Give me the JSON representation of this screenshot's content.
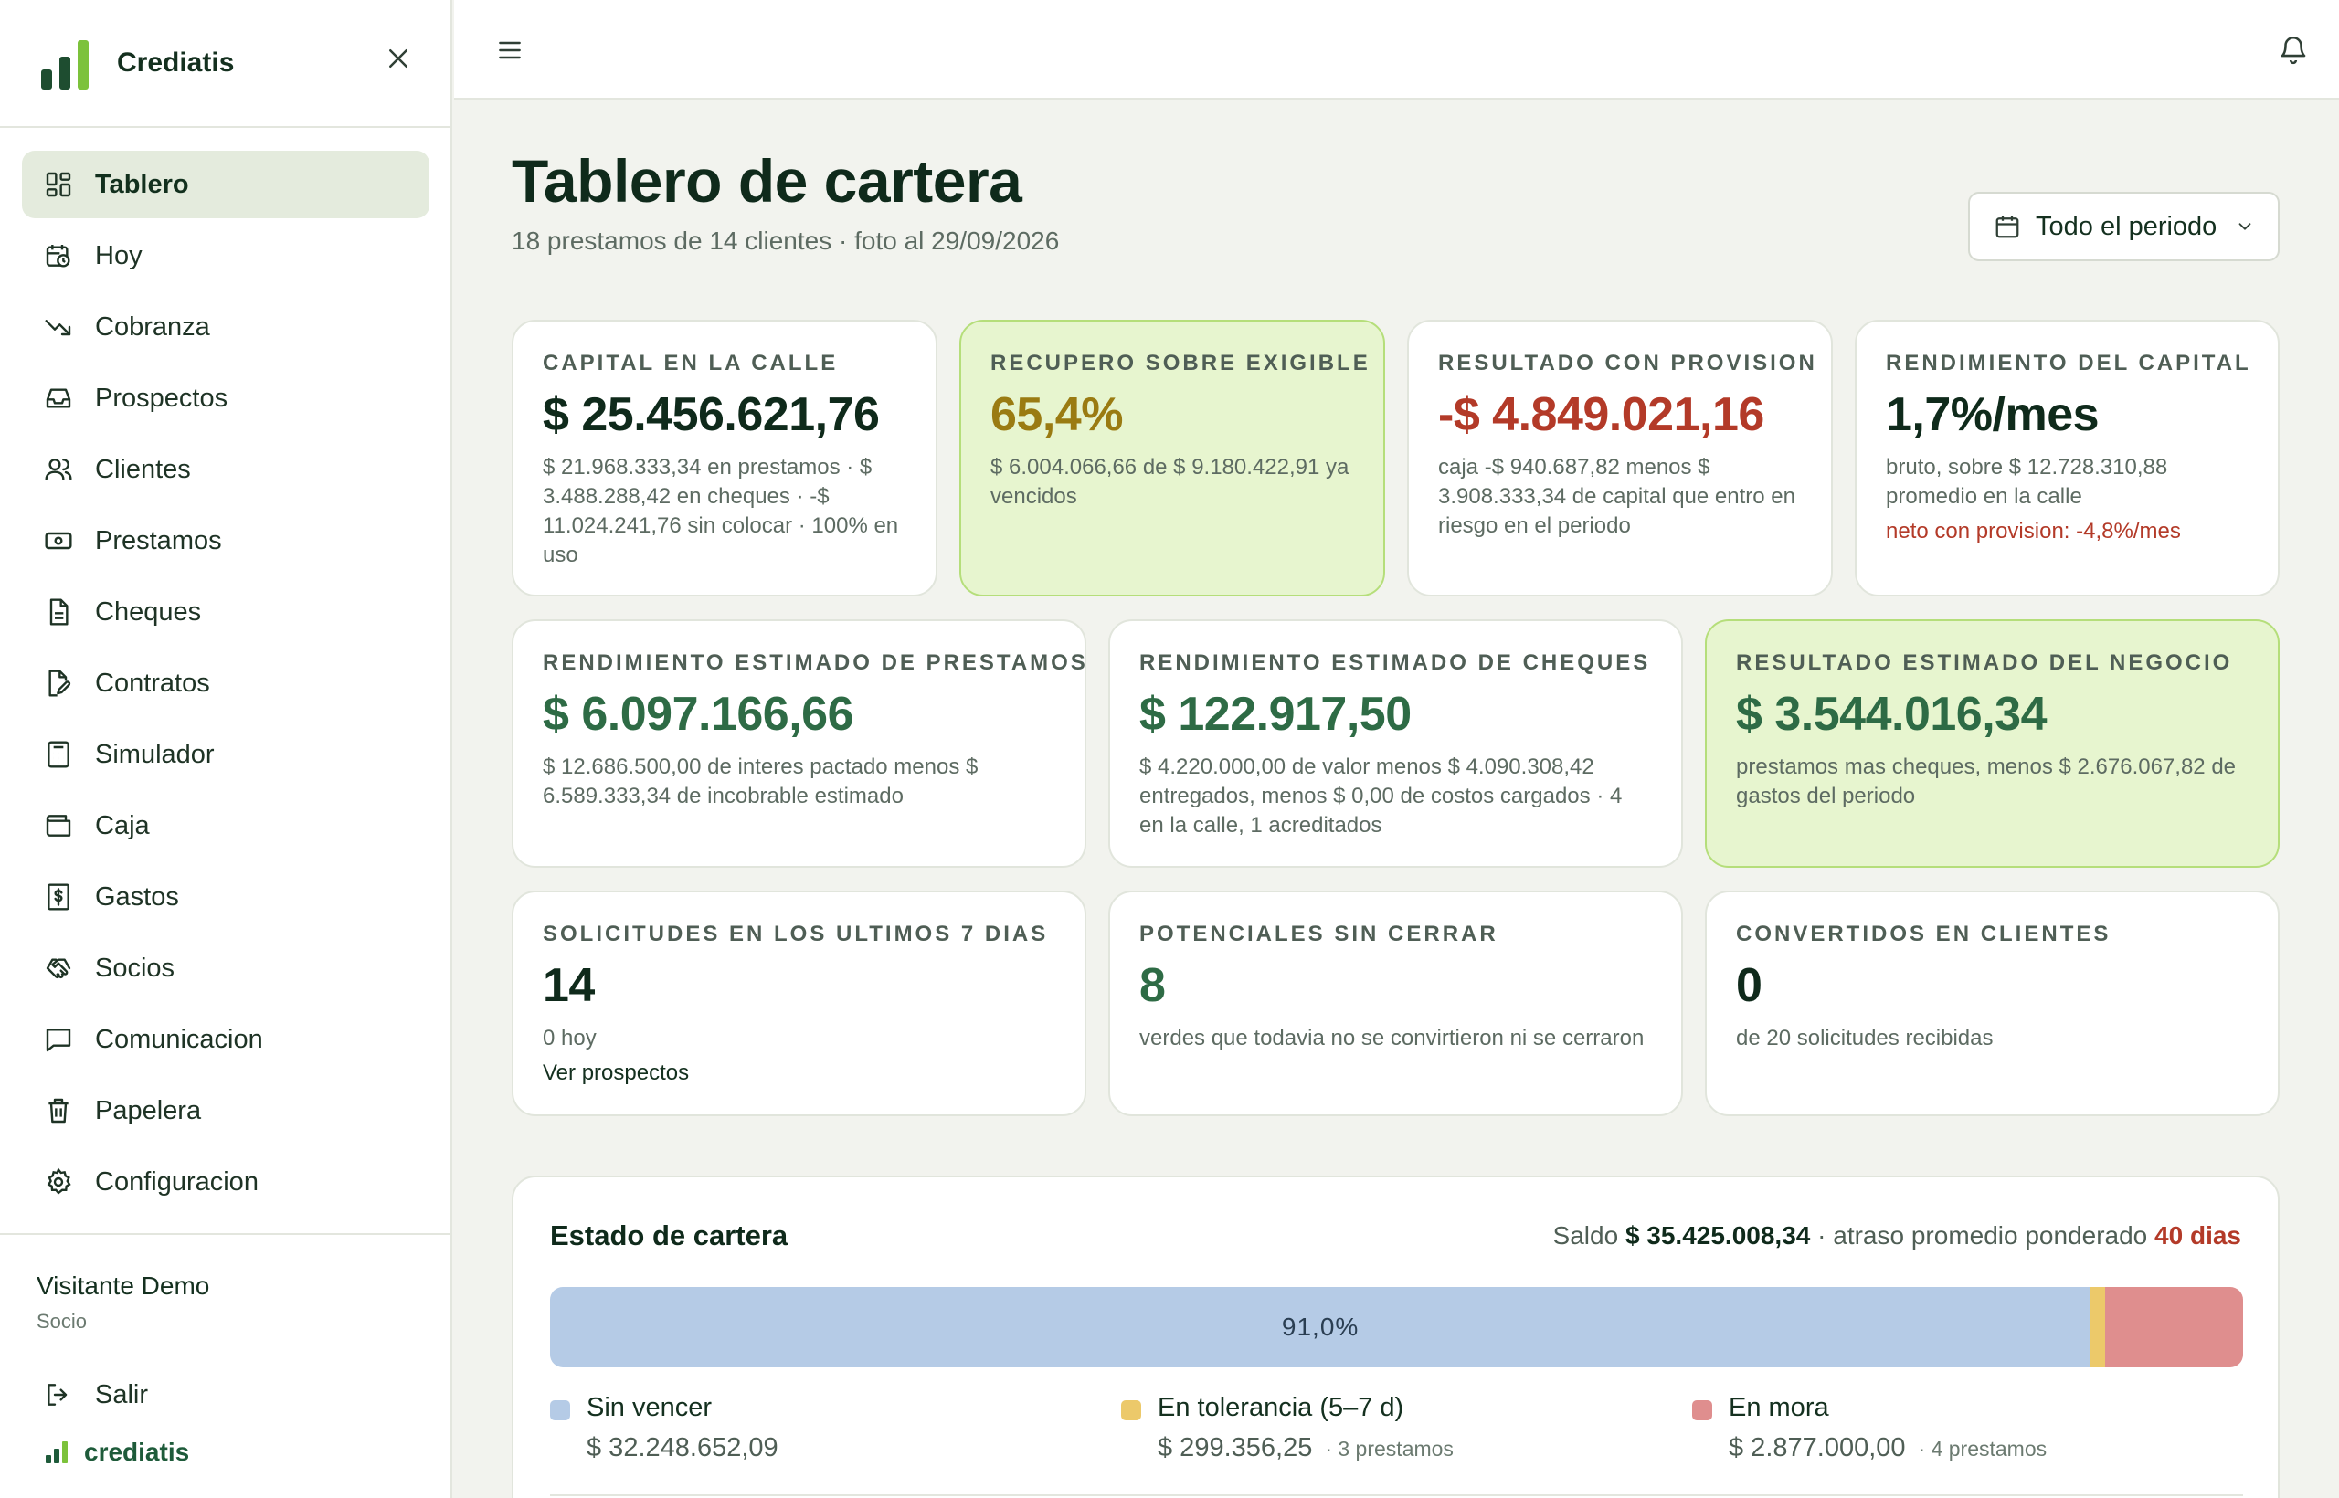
{
  "app": {
    "brand": "Crediatis",
    "footer_brand": "crediatis"
  },
  "sidebar": {
    "items": [
      {
        "label": "Tablero",
        "icon": "dashboard-icon",
        "active": true
      },
      {
        "label": "Hoy",
        "icon": "calendar-clock-icon"
      },
      {
        "label": "Cobranza",
        "icon": "trending-down-icon"
      },
      {
        "label": "Prospectos",
        "icon": "inbox-icon"
      },
      {
        "label": "Clientes",
        "icon": "users-icon"
      },
      {
        "label": "Prestamos",
        "icon": "banknote-icon"
      },
      {
        "label": "Cheques",
        "icon": "file-text-icon"
      },
      {
        "label": "Contratos",
        "icon": "file-signature-icon"
      },
      {
        "label": "Simulador",
        "icon": "calculator-icon"
      },
      {
        "label": "Caja",
        "icon": "wallet-icon"
      },
      {
        "label": "Gastos",
        "icon": "receipt-dollar-icon"
      },
      {
        "label": "Socios",
        "icon": "handshake-icon"
      },
      {
        "label": "Comunicacion",
        "icon": "message-square-icon"
      },
      {
        "label": "Papelera",
        "icon": "trash-icon"
      },
      {
        "label": "Configuracion",
        "icon": "gear-icon"
      }
    ],
    "user": {
      "name": "Visitante Demo",
      "role": "Socio"
    },
    "logout_label": "Salir"
  },
  "header": {
    "title": "Tablero de cartera",
    "subtitle": "18 prestamos de 14 clientes · foto al 29/09/2026",
    "period_label": "Todo el periodo"
  },
  "cards": {
    "capital": {
      "label": "Capital en la calle",
      "value": "$ 25.456.621,76",
      "desc": "$ 21.968.333,34 en prestamos · $ 3.488.288,42 en cheques · -$ 11.024.241,76 sin colocar · 100% en uso"
    },
    "recupero": {
      "label": "Recupero sobre exigible",
      "value": "65,4%",
      "desc": "$ 6.004.066,66 de $ 9.180.422,91 ya vencidos"
    },
    "resultado_provision": {
      "label": "Resultado con provision",
      "value": "-$ 4.849.021,16",
      "desc": "caja -$ 940.687,82 menos $ 3.908.333,34 de capital que entro en riesgo en el periodo"
    },
    "rendimiento_capital": {
      "label": "Rendimiento del capital",
      "value": "1,7%/mes",
      "desc": "bruto, sobre $ 12.728.310,88 promedio en la calle",
      "note": "neto con provision: -4,8%/mes"
    },
    "rend_prestamos": {
      "label": "Rendimiento estimado de prestamos",
      "value": "$ 6.097.166,66",
      "desc": "$ 12.686.500,00 de interes pactado menos $ 6.589.333,34 de incobrable estimado"
    },
    "rend_cheques": {
      "label": "Rendimiento estimado de cheques",
      "value": "$ 122.917,50",
      "desc": "$ 4.220.000,00 de valor menos $ 4.090.308,42 entregados, menos $ 0,00 de costos cargados · 4 en la calle, 1 acreditados"
    },
    "resultado_negocio": {
      "label": "Resultado estimado del negocio",
      "value": "$ 3.544.016,34",
      "desc": "prestamos mas cheques, menos $ 2.676.067,82 de gastos del periodo"
    },
    "solicitudes": {
      "label": "Solicitudes en los ultimos 7 dias",
      "value": "14",
      "desc": "0 hoy",
      "link": "Ver prospectos"
    },
    "potenciales": {
      "label": "Potenciales sin cerrar",
      "value": "8",
      "desc": "verdes que todavia no se convirtieron ni se cerraron"
    },
    "convertidos": {
      "label": "Convertidos en clientes",
      "value": "0",
      "desc": "de 20 solicitudes recibidas"
    }
  },
  "estado": {
    "title": "Estado de cartera",
    "saldo_prefix": "Saldo",
    "saldo": "$ 35.425.008,34",
    "atraso_prefix": "· atraso promedio ponderado",
    "atraso": "40 dias",
    "bar_label": "91,0%",
    "shares": {
      "sin_vencer": 0.91,
      "tolerancia": 0.0085,
      "mora": 0.0815
    },
    "segments": [
      {
        "name": "Sin vencer",
        "amount": "$ 32.248.652,09",
        "count": "",
        "color": "#b5cbe6"
      },
      {
        "name": "En tolerancia (5–7 d)",
        "amount": "$ 299.356,25",
        "count": "· 3 prestamos",
        "color": "#ecc96a"
      },
      {
        "name": "En mora",
        "amount": "$ 2.877.000,00",
        "count": "· 4 prestamos",
        "color": "#df8e8e"
      }
    ]
  },
  "colors": {
    "accent_green": "#2e6b45",
    "warning_gold": "#9a7b12",
    "danger_red": "#b33a28",
    "highlight_card": "#e7f5cf"
  }
}
